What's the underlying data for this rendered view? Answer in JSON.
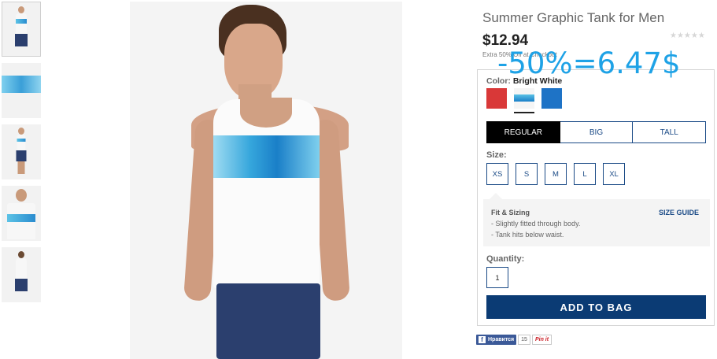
{
  "product": {
    "title": "Summer Graphic Tank for Men",
    "price": "$12.94",
    "extra_text": "Extra 50% Off at Checkout",
    "rating_stars": "★★★★★",
    "discount_overlay": "-50%=6.47$"
  },
  "color": {
    "label": "Color:",
    "selected": "Bright White",
    "swatches": [
      {
        "name": "red",
        "color": "#d93838"
      },
      {
        "name": "bright-white-graphic",
        "color": "#5cc3e6"
      },
      {
        "name": "blue",
        "color": "#1e73c6"
      }
    ]
  },
  "fits": [
    "REGULAR",
    "BIG",
    "TALL"
  ],
  "size": {
    "label": "Size:",
    "options": [
      "XS",
      "S",
      "M",
      "L",
      "XL"
    ]
  },
  "fit_sizing": {
    "title": "Fit & Sizing",
    "guide": "SIZE GUIDE",
    "lines": [
      "- Slightly fitted through body.",
      "- Tank hits below waist."
    ]
  },
  "quantity": {
    "label": "Quantity:",
    "value": "1"
  },
  "add_to_bag": "ADD TO BAG",
  "social": {
    "facebook_label": "Нравится",
    "count": "15",
    "pin_label": "Pin it"
  },
  "colors": {
    "accent_blue": "#0b3b74",
    "overlay_blue": "#1ea2e6"
  }
}
